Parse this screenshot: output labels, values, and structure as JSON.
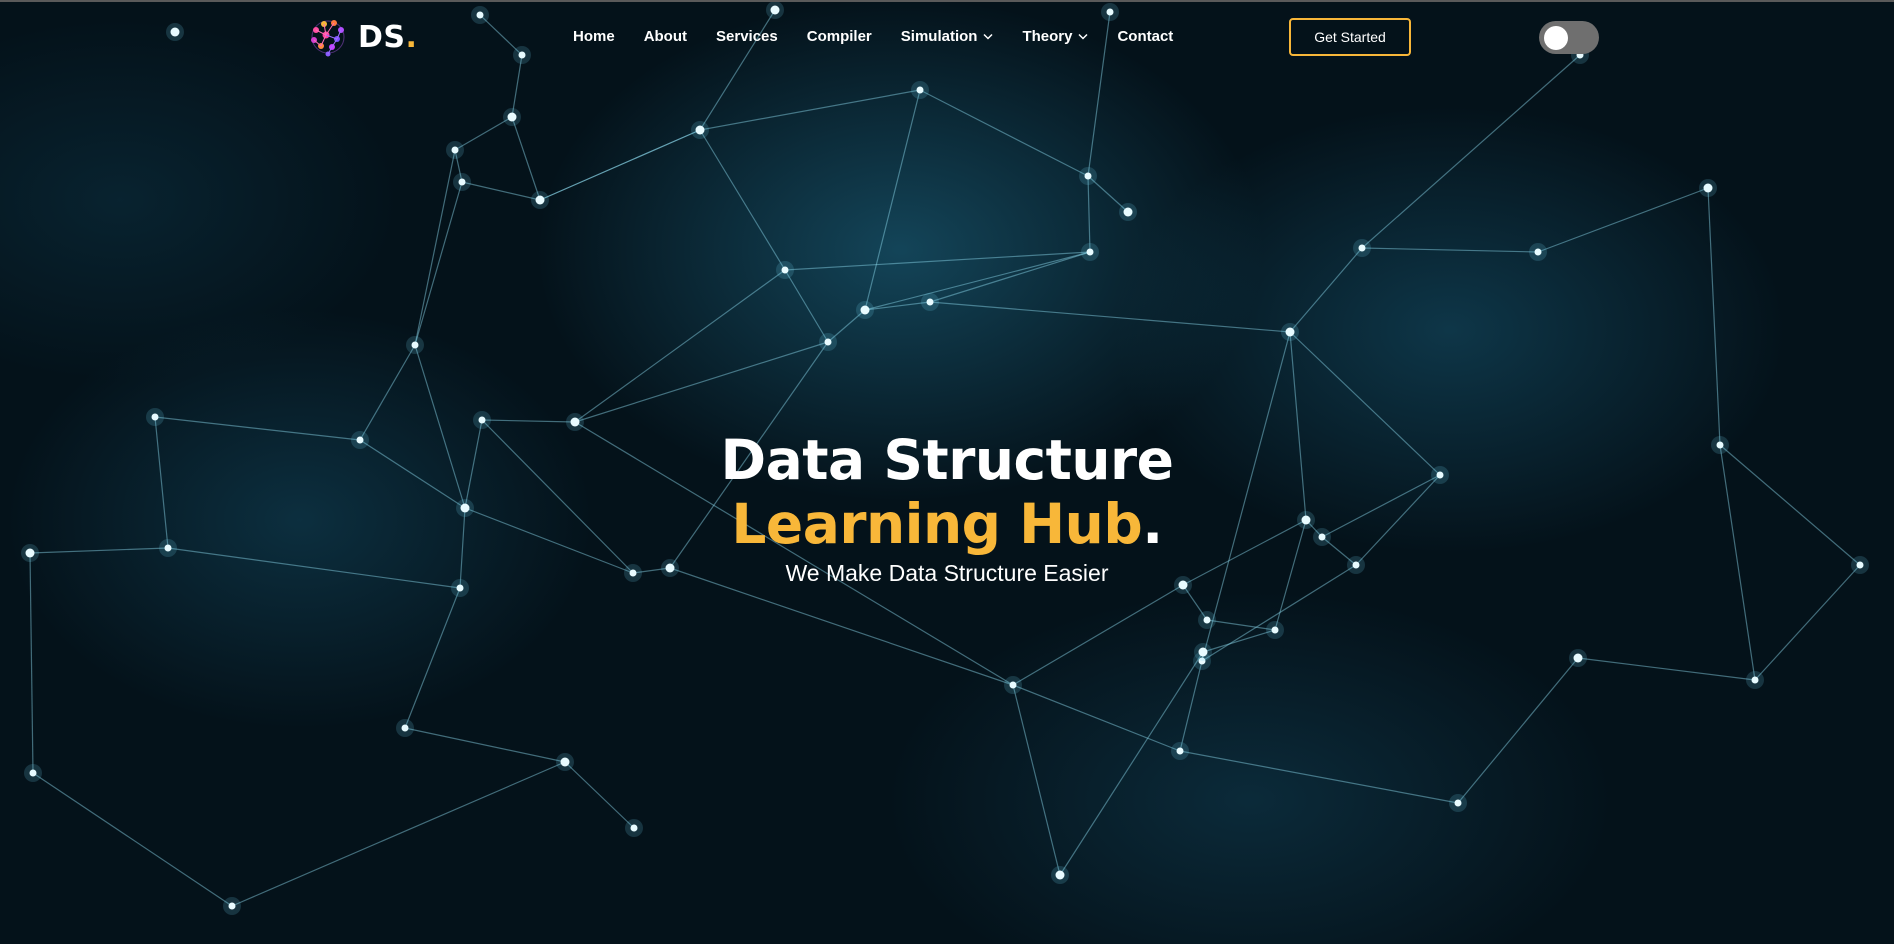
{
  "brand": {
    "name": "DS",
    "dot": "."
  },
  "nav": {
    "items": [
      {
        "label": "Home",
        "active": true,
        "dropdown": false
      },
      {
        "label": "About",
        "active": false,
        "dropdown": false
      },
      {
        "label": "Services",
        "active": false,
        "dropdown": false
      },
      {
        "label": "Compiler",
        "active": false,
        "dropdown": false
      },
      {
        "label": "Simulation",
        "active": false,
        "dropdown": true
      },
      {
        "label": "Theory",
        "active": false,
        "dropdown": true
      },
      {
        "label": "Contact",
        "active": false,
        "dropdown": false
      }
    ],
    "cta_label": "Get Started"
  },
  "theme_toggle": {
    "on": false
  },
  "hero": {
    "title_line1": "Data Structure",
    "title_line2": "Learning Hub",
    "title_dot": ".",
    "subtitle": "We Make Data Structure Easier"
  },
  "colors": {
    "accent": "#f8b739",
    "background": "#04121a",
    "network": "#8fdcf0"
  },
  "icons": {
    "logo": "brain-network-icon",
    "dropdown": "chevron-down-icon"
  }
}
